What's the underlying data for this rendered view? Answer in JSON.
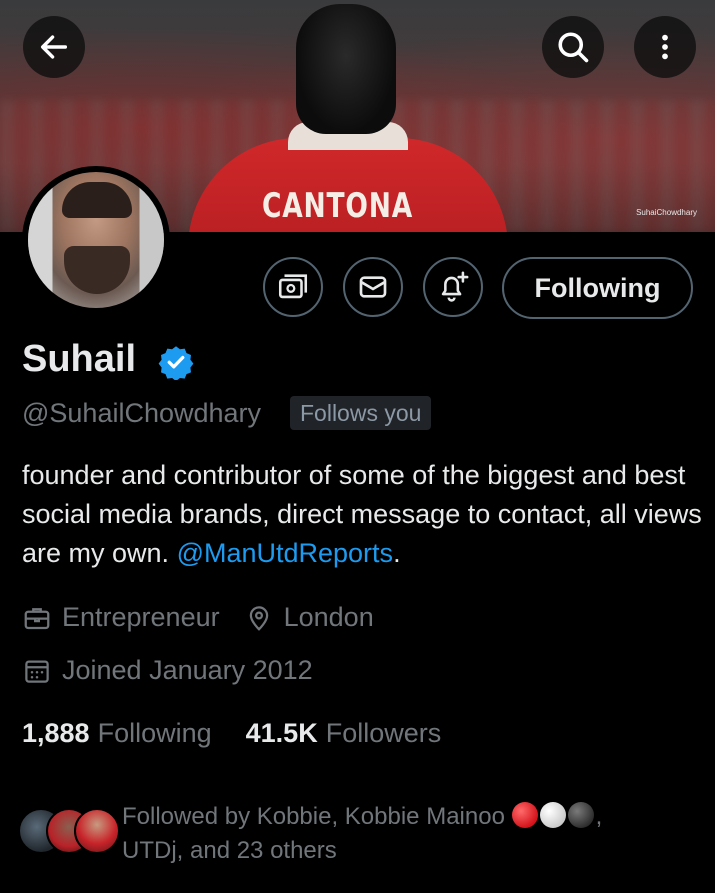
{
  "banner": {
    "shirt_name": "CANTONA",
    "watermark": "SuhaiChowdhary"
  },
  "header": {
    "back_icon": "arrow-left-icon",
    "search_icon": "search-icon",
    "more_icon": "more-vertical-icon"
  },
  "actions": {
    "subscribe_icon": "money-icon",
    "message_icon": "mail-icon",
    "notify_icon": "bell-plus-icon",
    "follow_label": "Following"
  },
  "profile": {
    "name": "Suhail",
    "handle": "@SuhailChowdhary",
    "follows_you": "Follows you",
    "bio_text": "founder and contributor of some of the biggest and best social media brands, direct message to contact, all views are my own. ",
    "bio_mention": "@ManUtdReports",
    "bio_end": ".",
    "profession": "Entrepreneur",
    "location": "London",
    "joined": "Joined January 2012"
  },
  "stats": {
    "following_count": "1,888",
    "following_label": "Following",
    "followers_count": "41.5K",
    "followers_label": "Followers"
  },
  "followed_by": {
    "line1": "Followed by Kobbie, Kobbie Mainoo",
    "line1_end": ",",
    "line2": "UTDj, and 23 others",
    "emoji_colors": [
      "#e0262c",
      "#e6e6e6",
      "#444444"
    ]
  },
  "colors": {
    "accent": "#1d9bf0",
    "muted": "#71767b",
    "border": "#536471"
  }
}
